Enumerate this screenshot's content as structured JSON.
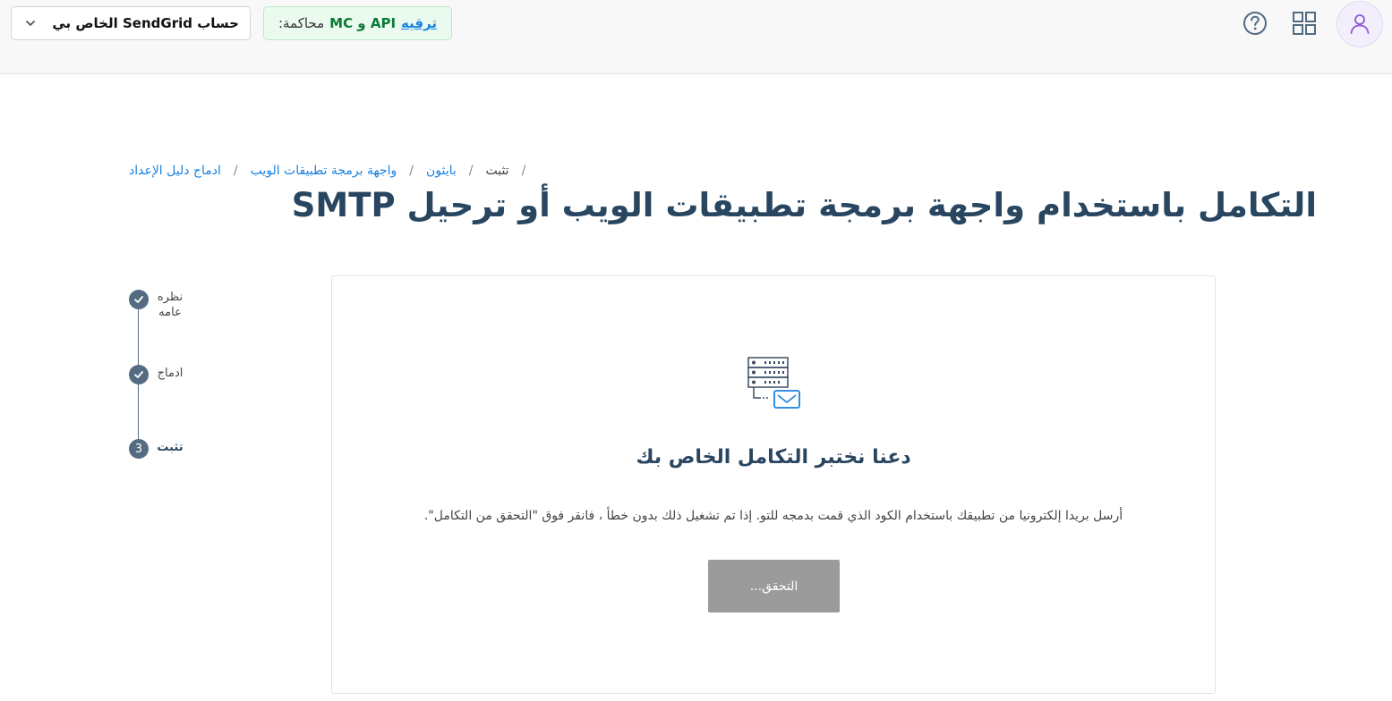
{
  "header": {
    "account_select": "حساب SendGrid الخاص بي",
    "trial_badge": {
      "upgrade": "ترقيه",
      "plans": "API و MC",
      "trial": "محاكمة:"
    },
    "icons": [
      "help-circle-icon",
      "apps-grid-icon",
      "user-icon"
    ]
  },
  "breadcrumb": {
    "items": [
      "ادماج دليل الإعداد",
      "واجهة برمجة تطبيقات الويب",
      "بايثون"
    ],
    "current": "تثبت",
    "separator": "/"
  },
  "page": {
    "title": "التكامل باستخدام واجهة برمجة تطبيقات الويب أو ترحيل SMTP"
  },
  "stepper": {
    "steps": [
      {
        "label": "نظره عامه",
        "status": "complete"
      },
      {
        "label": "ادماج",
        "status": "complete"
      },
      {
        "label": "تثبت",
        "status": "current",
        "number": "3"
      }
    ]
  },
  "card": {
    "heading": "دعنا نختبر التكامل الخاص بك",
    "description": "أرسل بريدا إلكترونيا من تطبيقك باستخدام الكود الذي قمت بدمجه للتو. إذا تم تشغيل ذلك بدون خطأ ، فانقر فوق \"التحقق من التكامل\".",
    "verify_button": "التحقق..."
  },
  "colors": {
    "title": "#294661",
    "link": "#1a82e2",
    "stepper": "#546b81",
    "button_disabled": "#9b9b9b",
    "trial_bg": "#ebfaef"
  }
}
